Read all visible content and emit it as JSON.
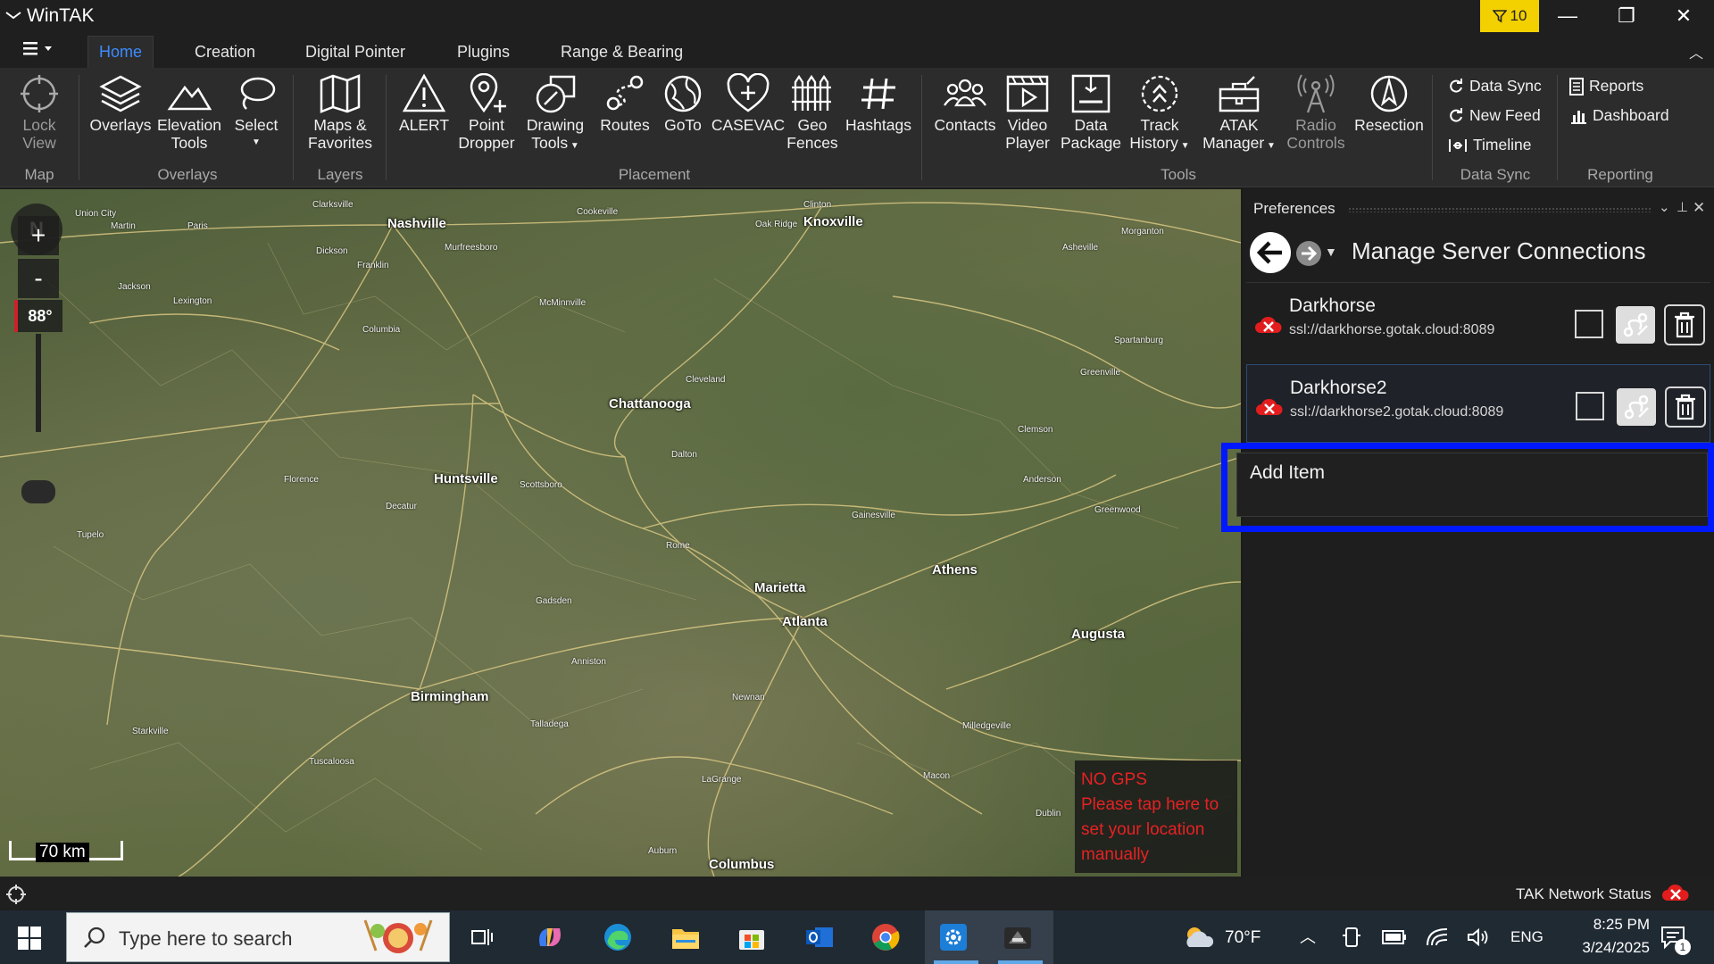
{
  "app": {
    "title": "WinTAK",
    "filter_count": "10",
    "minimize": "—",
    "restore": "❐",
    "close": "✕"
  },
  "tabs": [
    {
      "label": "Home"
    },
    {
      "label": "Creation"
    },
    {
      "label": "Digital Pointer"
    },
    {
      "label": "Plugins"
    },
    {
      "label": "Range & Bearing"
    }
  ],
  "ribbon": {
    "map": {
      "label": "Map",
      "lock_view_1": "Lock",
      "lock_view_2": "View"
    },
    "overlays": {
      "label": "Overlays",
      "overlays": "Overlays",
      "elevation_1": "Elevation",
      "elevation_2": "Tools",
      "select": "Select"
    },
    "layers": {
      "label": "Layers",
      "maps_1": "Maps &",
      "maps_2": "Favorites"
    },
    "placement": {
      "label": "Placement",
      "alert": "ALERT",
      "point_1": "Point",
      "point_2": "Dropper",
      "drawing_1": "Drawing",
      "drawing_2": "Tools",
      "routes": "Routes",
      "goto": "GoTo",
      "casevac": "CASEVAC",
      "geo_1": "Geo",
      "geo_2": "Fences",
      "hashtags": "Hashtags"
    },
    "tools": {
      "label": "Tools",
      "contacts": "Contacts",
      "video_1": "Video",
      "video_2": "Player",
      "data_1": "Data",
      "data_2": "Package",
      "track_1": "Track",
      "track_2": "History",
      "atak_1": "ATAK",
      "atak_2": "Manager",
      "radio_1": "Radio",
      "radio_2": "Controls",
      "resection": "Resection"
    },
    "datasync": {
      "label": "Data Sync",
      "data_sync": "Data Sync",
      "new_feed": "New Feed",
      "timeline": "Timeline"
    },
    "reporting": {
      "label": "Reporting",
      "reports": "Reports",
      "dashboard": "Dashboard"
    }
  },
  "map": {
    "compass": "N",
    "zoom_in": "+",
    "zoom_out": "-",
    "tilt": "88°",
    "scale": "70 km",
    "nogps_1": "NO GPS",
    "nogps_2": "Please tap here to",
    "nogps_3": "set your location",
    "nogps_4": "manually",
    "cities": [
      "Nashville",
      "Knoxville",
      "Chattanooga",
      "Huntsville",
      "Athens",
      "Marietta",
      "Atlanta",
      "Birmingham",
      "Augusta",
      "Columbus"
    ],
    "towns": [
      "Union City",
      "Martin",
      "Paris",
      "Clarksville",
      "Cookeville",
      "Clinton",
      "Oak Ridge",
      "Morganton",
      "Jackson",
      "Lexington",
      "Dickson",
      "Franklin",
      "Murfreesboro",
      "McMinnville",
      "Cleveland",
      "Dalton",
      "Florence",
      "Decatur",
      "Scottsboro",
      "Gadsden",
      "Rome",
      "Gainesville",
      "Anderson",
      "Greenwood",
      "Tuscaloosa",
      "Talladega",
      "Anniston",
      "Newnan",
      "LaGrange",
      "Macon",
      "Milledgeville",
      "Dublin",
      "Auburn",
      "Tupelo",
      "Starkville",
      "Columbia",
      "Asheville",
      "Greenville",
      "Spartanburg",
      "Clemson"
    ]
  },
  "prefs": {
    "title": "Preferences",
    "heading": "Manage Server Connections",
    "servers": [
      {
        "name": "Darkhorse",
        "url": "ssl://darkhorse.gotak.cloud:8089"
      },
      {
        "name": "Darkhorse2",
        "url": "ssl://darkhorse2.gotak.cloud:8089"
      }
    ],
    "add_item": "Add Item"
  },
  "status": {
    "tak_network": "TAK Network Status"
  },
  "taskbar": {
    "search_placeholder": "Type here to search",
    "weather": "70°F",
    "language": "ENG",
    "time": "8:25 PM",
    "date": "3/24/2025",
    "notifications": "1"
  },
  "colors": {
    "accent": "#3d8bff",
    "highlight": "#0018ff",
    "error": "#e62222",
    "filter": "#f3d000"
  }
}
